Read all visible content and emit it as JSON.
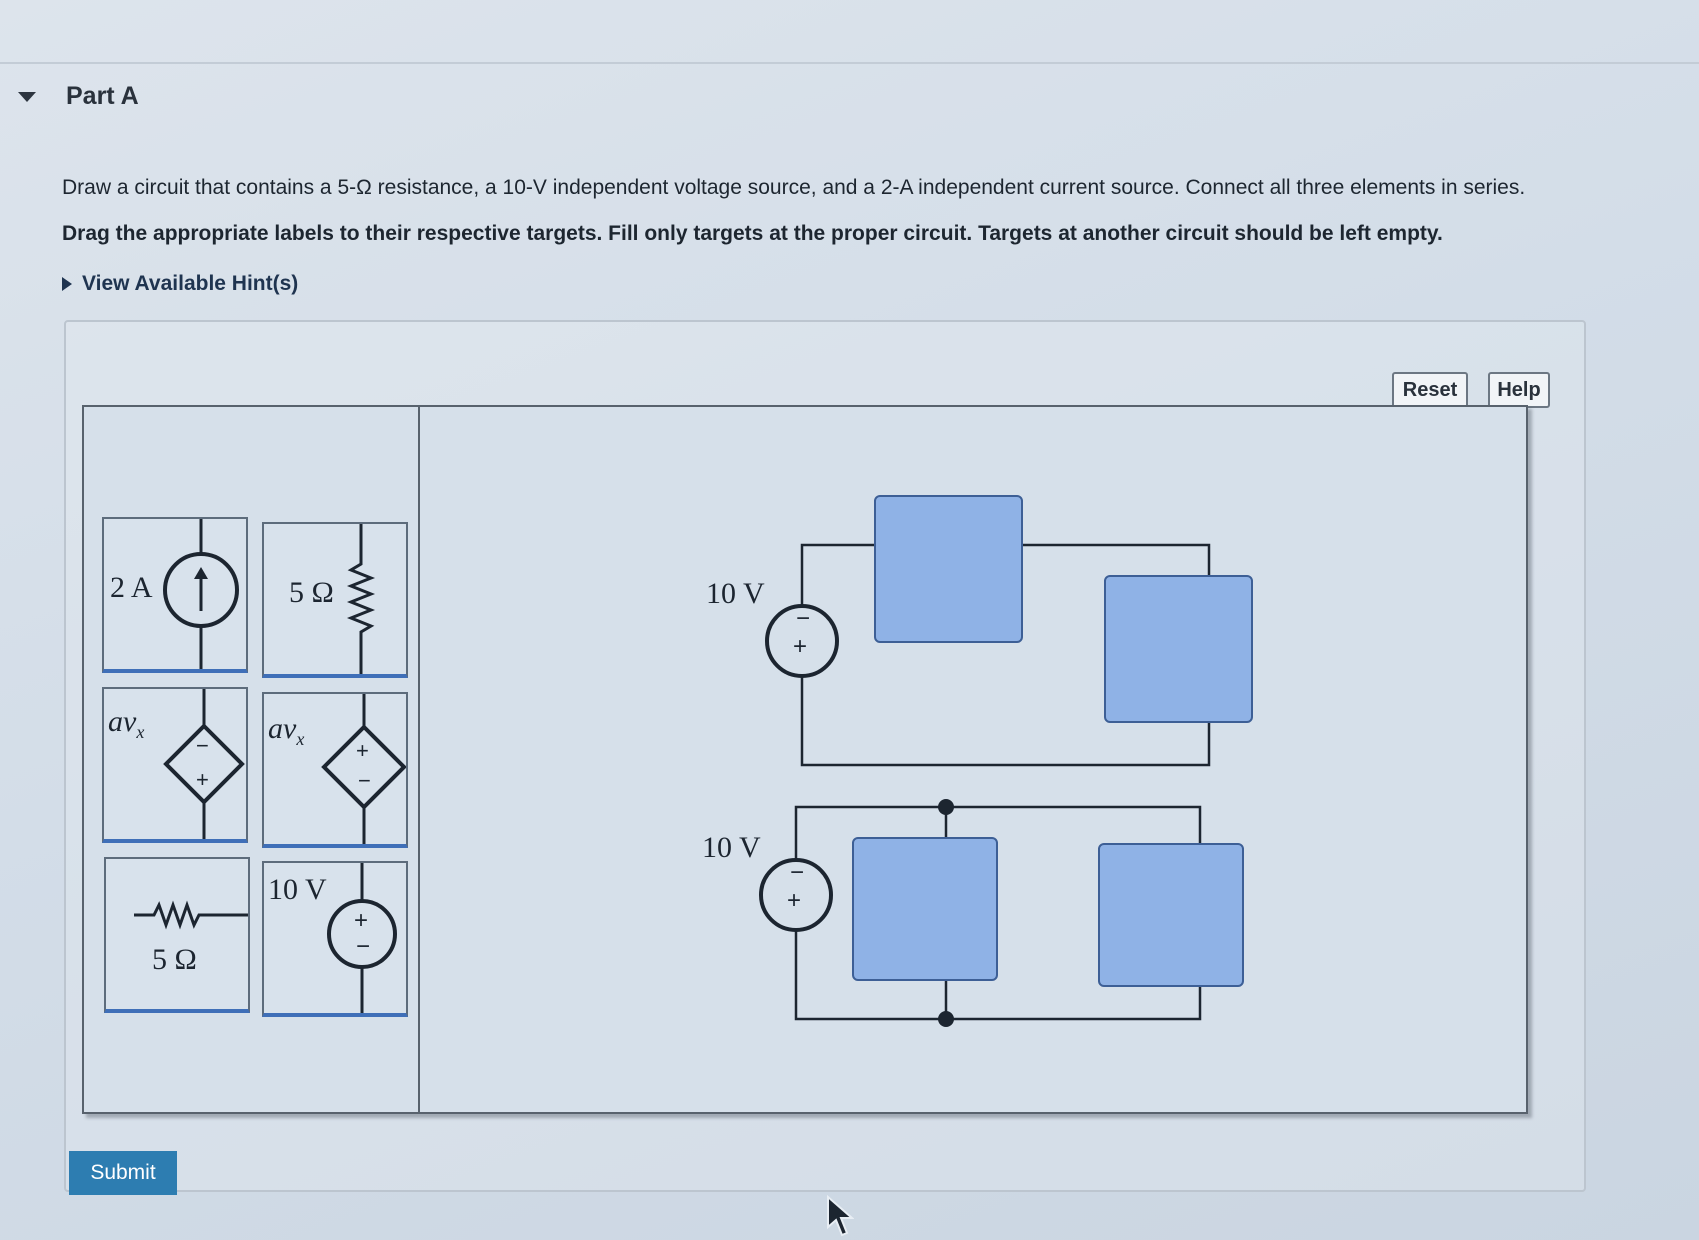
{
  "part": {
    "title": "Part A"
  },
  "instructions": {
    "text": "Draw a circuit that contains a 5-Ω resistance, a 10-V independent voltage source, and a 2-A independent current source. Connect all three elements in series.",
    "bold": "Drag the appropriate labels to their respective targets. Fill only targets at the proper circuit. Targets at another circuit should be left empty."
  },
  "hint": {
    "label": "View Available Hint(s)"
  },
  "toolbar": {
    "reset_label": "Reset",
    "help_label": "Help"
  },
  "palette": {
    "current_source": {
      "label": "2 A"
    },
    "resistor_vertical": {
      "label": "5 Ω"
    },
    "dep_source_1": {
      "label": "av",
      "subscript": "x",
      "top_sign": "−",
      "bottom_sign": "+"
    },
    "dep_source_2": {
      "label": "av",
      "subscript": "x",
      "top_sign": "+",
      "bottom_sign": "−"
    },
    "resistor_horizontal": {
      "label": "5 Ω"
    },
    "voltage_source": {
      "label": "10 V",
      "top_sign": "+",
      "bottom_sign": "−"
    }
  },
  "circuits": {
    "top": {
      "source_label": "10 V",
      "top_sign": "−",
      "bottom_sign": "+"
    },
    "bottom": {
      "source_label": "10 V",
      "top_sign": "−",
      "bottom_sign": "+"
    }
  },
  "submit": {
    "label": "Submit"
  },
  "colors": {
    "target_fill": "#8fb2e6",
    "submit_bg": "#2d7db1",
    "tile_underline": "#3f6fb8"
  }
}
